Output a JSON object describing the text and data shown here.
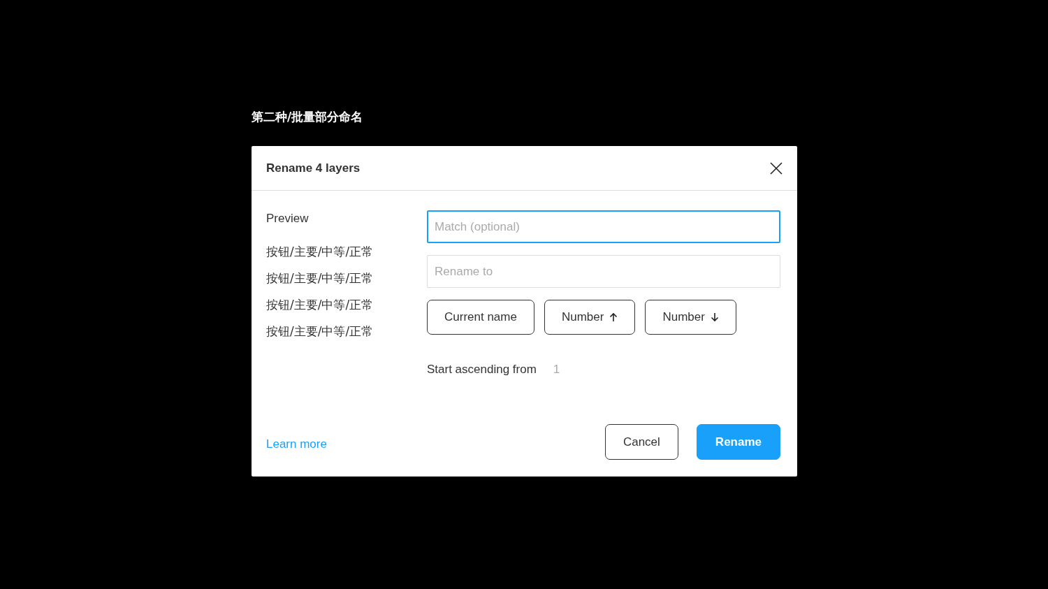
{
  "heading": "第二种/批量部分命名",
  "dialog": {
    "title": "Rename 4 layers",
    "preview": {
      "label": "Preview",
      "names": [
        "按钮/主要/中等/正常",
        "按钮/主要/中等/正常",
        "按钮/主要/中等/正常",
        "按钮/主要/中等/正常"
      ]
    },
    "fields": [
      {
        "placeholder": "Match (optional)",
        "focused": true
      },
      {
        "placeholder": "Rename to",
        "focused": false
      }
    ],
    "tokens": [
      {
        "label": "Current name",
        "kind": "plain"
      },
      {
        "label": "Number",
        "kind": "up"
      },
      {
        "label": "Number",
        "kind": "down"
      }
    ],
    "start": {
      "label": "Start ascending from",
      "placeholder": "1"
    },
    "learn_more": "Learn more",
    "buttons": [
      {
        "label": "Cancel",
        "kind": "secondary"
      },
      {
        "label": "Rename",
        "kind": "primary"
      }
    ]
  }
}
